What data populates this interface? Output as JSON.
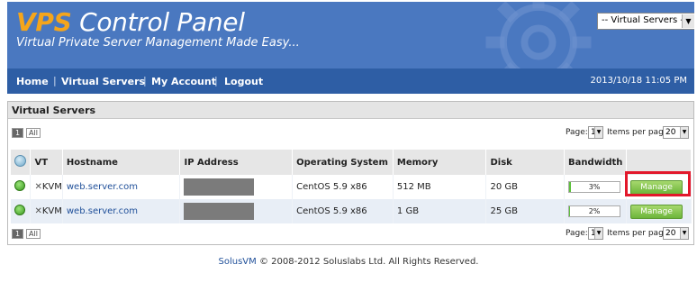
{
  "header": {
    "brand_vps": "VPS",
    "brand_rest": "Control Panel",
    "tagline": "Virtual Private Server Management Made Easy...",
    "server_select": "-- Virtual Servers --"
  },
  "nav": {
    "items": [
      "Home",
      "Virtual Servers",
      "My Account",
      "Logout"
    ],
    "separator": "|",
    "datetime": "2013/10/18 11:05 PM"
  },
  "panel": {
    "title": "Virtual Servers",
    "pager": {
      "current_page": "1",
      "all_label": "All",
      "page_label": "Page:",
      "page_value": "1",
      "per_page_label": "Items per page:",
      "per_page_value": "20"
    },
    "columns": [
      "VT",
      "Hostname",
      "IP Address",
      "Operating System",
      "Memory",
      "Disk",
      "Bandwidth"
    ],
    "rows": [
      {
        "vt": "KVM",
        "hostname": "web.server.com",
        "os": "CentOS 5.9 x86",
        "memory": "512 MB",
        "disk": "20 GB",
        "bandwidth": "3%",
        "bandwidth_frac": 0.03,
        "action": "Manage"
      },
      {
        "vt": "KVM",
        "hostname": "web.server.com",
        "os": "CentOS 5.9 x86",
        "memory": "1 GB",
        "disk": "25 GB",
        "bandwidth": "2%",
        "bandwidth_frac": 0.02,
        "action": "Manage"
      }
    ]
  },
  "footer": {
    "solus": "SolusVM",
    "copyright": "© 2008-2012 Soluslabs Ltd. All Rights Reserved."
  },
  "colors": {
    "header_bg": "#4a78c0",
    "nav_bg": "#2e5ea5",
    "brand_accent": "#f4a51c",
    "highlight": "#e2182b",
    "status_online": "#3a9a20"
  },
  "icons": {
    "gear": "gear-icon",
    "status": "online-status-icon",
    "vt": "kvm-icon"
  }
}
